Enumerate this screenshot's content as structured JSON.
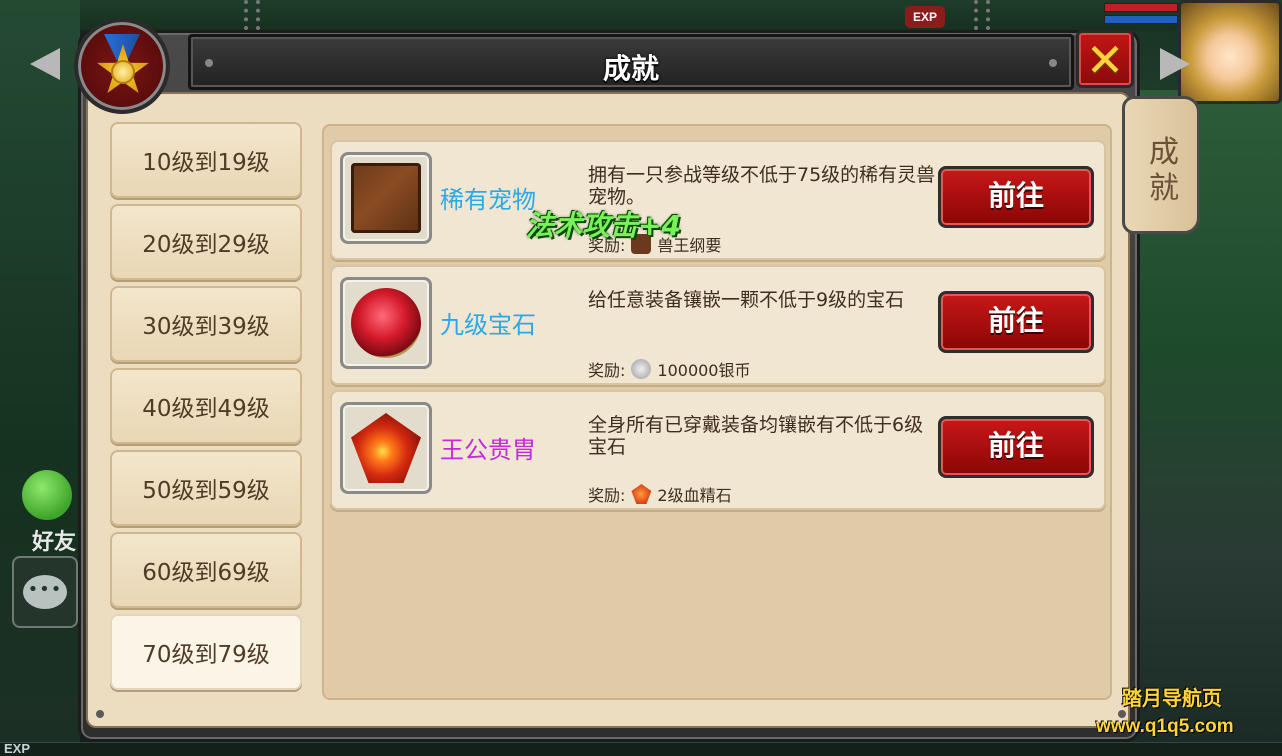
{
  "window": {
    "title": "成就"
  },
  "side_tab": {
    "label": "成就"
  },
  "close_label": "✕",
  "top_hud": {
    "exp_badge": "EXP"
  },
  "bottom_hud": {
    "exp_label": "EXP"
  },
  "left_hud": {
    "friends_label": "好友"
  },
  "levels": [
    {
      "label": "10级到19级",
      "selected": false
    },
    {
      "label": "20级到29级",
      "selected": false
    },
    {
      "label": "30级到39级",
      "selected": false
    },
    {
      "label": "40级到49级",
      "selected": false
    },
    {
      "label": "50级到59级",
      "selected": false
    },
    {
      "label": "60级到69级",
      "selected": false
    },
    {
      "label": "70级到79级",
      "selected": true
    }
  ],
  "achievements": [
    {
      "name": "稀有宠物",
      "name_color": "#2aa9e6",
      "icon": "book-icon",
      "description": "拥有一只参战等级不低于75级的稀有灵兽宠物。",
      "reward_prefix": "奖励:",
      "reward_icon": "book-icon",
      "reward": "兽王纲要",
      "button": "前往"
    },
    {
      "name": "九级宝石",
      "name_color": "#2aa9e6",
      "icon": "red-gem-ring-icon",
      "description": "给任意装备镶嵌一颗不低于9级的宝石",
      "reward_prefix": "奖励:",
      "reward_icon": "silver-coin-icon",
      "reward": "100000银币",
      "button": "前往"
    },
    {
      "name": "王公贵胄",
      "name_color": "#c42ad6",
      "icon": "blood-crystal-icon",
      "description": "全身所有已穿戴装备均镶嵌有不低于6级宝石",
      "reward_prefix": "奖励:",
      "reward_icon": "blood-crystal-icon",
      "reward": "2级血精石",
      "button": "前往"
    }
  ],
  "floating_text": "法术攻击+4",
  "watermark": {
    "line1": "踏月导航页",
    "line2": "www.q1q5.com"
  }
}
